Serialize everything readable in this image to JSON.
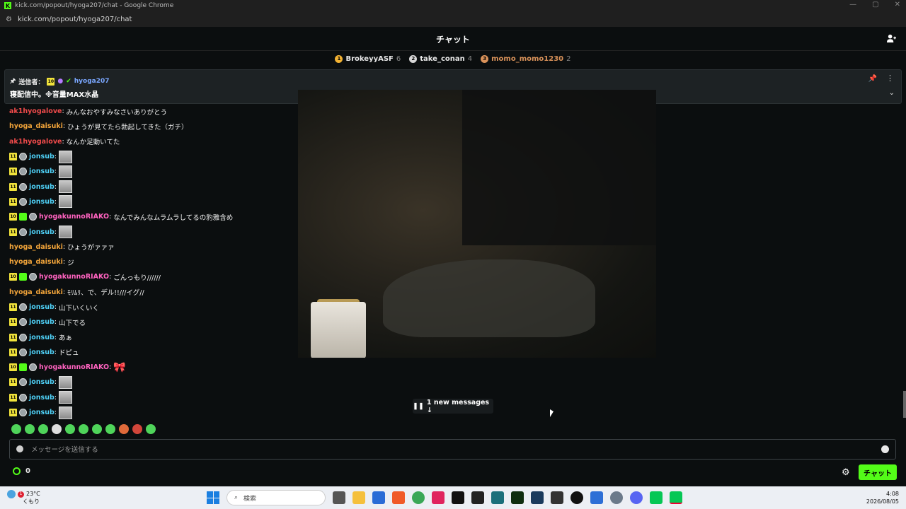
{
  "browser": {
    "window_title": "kick.com/popout/hyoga207/chat - Google Chrome",
    "url": "kick.com/popout/hyoga207/chat"
  },
  "header": {
    "title": "チャット"
  },
  "leaderboard": [
    {
      "rank": "1",
      "name": "BrokeyyASF",
      "count": "6",
      "color": "#f2b233"
    },
    {
      "rank": "2",
      "name": "take_conan",
      "count": "4",
      "color": "#d7d7d7"
    },
    {
      "rank": "3",
      "name": "momo_momo1230",
      "count": "2",
      "color": "#d9925a"
    }
  ],
  "pinned": {
    "sender_label": "送信者：",
    "badge": "10",
    "username": "hyoga207",
    "message": "寝配信中。※音量MAX水晶"
  },
  "messages": [
    {
      "user": "ak1hyogalove",
      "color": "#f04b4b",
      "text": "みんなおやすみなさいありがとう"
    },
    {
      "user": "hyoga_daisuki",
      "color": "#f3a53a",
      "text": "ひょうが見てたら勃起してきた（ガチ）"
    },
    {
      "user": "ak1hyogalove",
      "color": "#f04b4b",
      "text": "なんか足動いてた"
    },
    {
      "user": "jonsub",
      "color": "#4fd1f7",
      "badge": "11",
      "text": ""
    },
    {
      "user": "jonsub",
      "color": "#4fd1f7",
      "badge": "11",
      "text": ""
    },
    {
      "user": "jonsub",
      "color": "#4fd1f7",
      "badge": "11",
      "text": ""
    },
    {
      "user": "jonsub",
      "color": "#4fd1f7",
      "badge": "11",
      "text": ""
    },
    {
      "user": "hyogakunnoRIAKO",
      "color": "#ff63c0",
      "badge": "10",
      "text": "なんでみんなムラムラしてるの豹雅含め"
    },
    {
      "user": "jonsub",
      "color": "#4fd1f7",
      "badge": "11",
      "text": ""
    },
    {
      "user": "hyoga_daisuki",
      "color": "#f3a53a",
      "text": "ひょうがァァァ"
    },
    {
      "user": "hyoga_daisuki",
      "color": "#f3a53a",
      "text": "ジ"
    },
    {
      "user": "hyogakunnoRIAKO",
      "color": "#ff63c0",
      "badge": "10",
      "text": "ごんっもり//////"
    },
    {
      "user": "hyoga_daisuki",
      "color": "#f3a53a",
      "text": "ﾓﾘﾑﾘ、で、デル!!///イグ//"
    },
    {
      "user": "jonsub",
      "color": "#4fd1f7",
      "badge": "11",
      "text": "山下いくいく"
    },
    {
      "user": "jonsub",
      "color": "#4fd1f7",
      "badge": "11",
      "text": "山下でる"
    },
    {
      "user": "jonsub",
      "color": "#4fd1f7",
      "badge": "11",
      "text": "あぁ"
    },
    {
      "user": "jonsub",
      "color": "#4fd1f7",
      "badge": "11",
      "text": "ドピュ"
    },
    {
      "user": "hyogakunnoRIAKO",
      "color": "#ff63c0",
      "badge": "10",
      "text": ""
    },
    {
      "user": "jonsub",
      "color": "#4fd1f7",
      "badge": "11",
      "text": ""
    },
    {
      "user": "jonsub",
      "color": "#4fd1f7",
      "badge": "11",
      "text": ""
    },
    {
      "user": "jonsub",
      "color": "#4fd1f7",
      "badge": "11",
      "text": ""
    }
  ],
  "new_messages": "1 new messages ↓",
  "composer": {
    "placeholder": "メッセージを送信する"
  },
  "points": "0",
  "send_label": "チャット",
  "taskbar": {
    "temp": "23°C",
    "weather": "くもり",
    "alert_count": "1",
    "search_placeholder": "検索",
    "time": "4:08",
    "date": "2026/08/05"
  }
}
